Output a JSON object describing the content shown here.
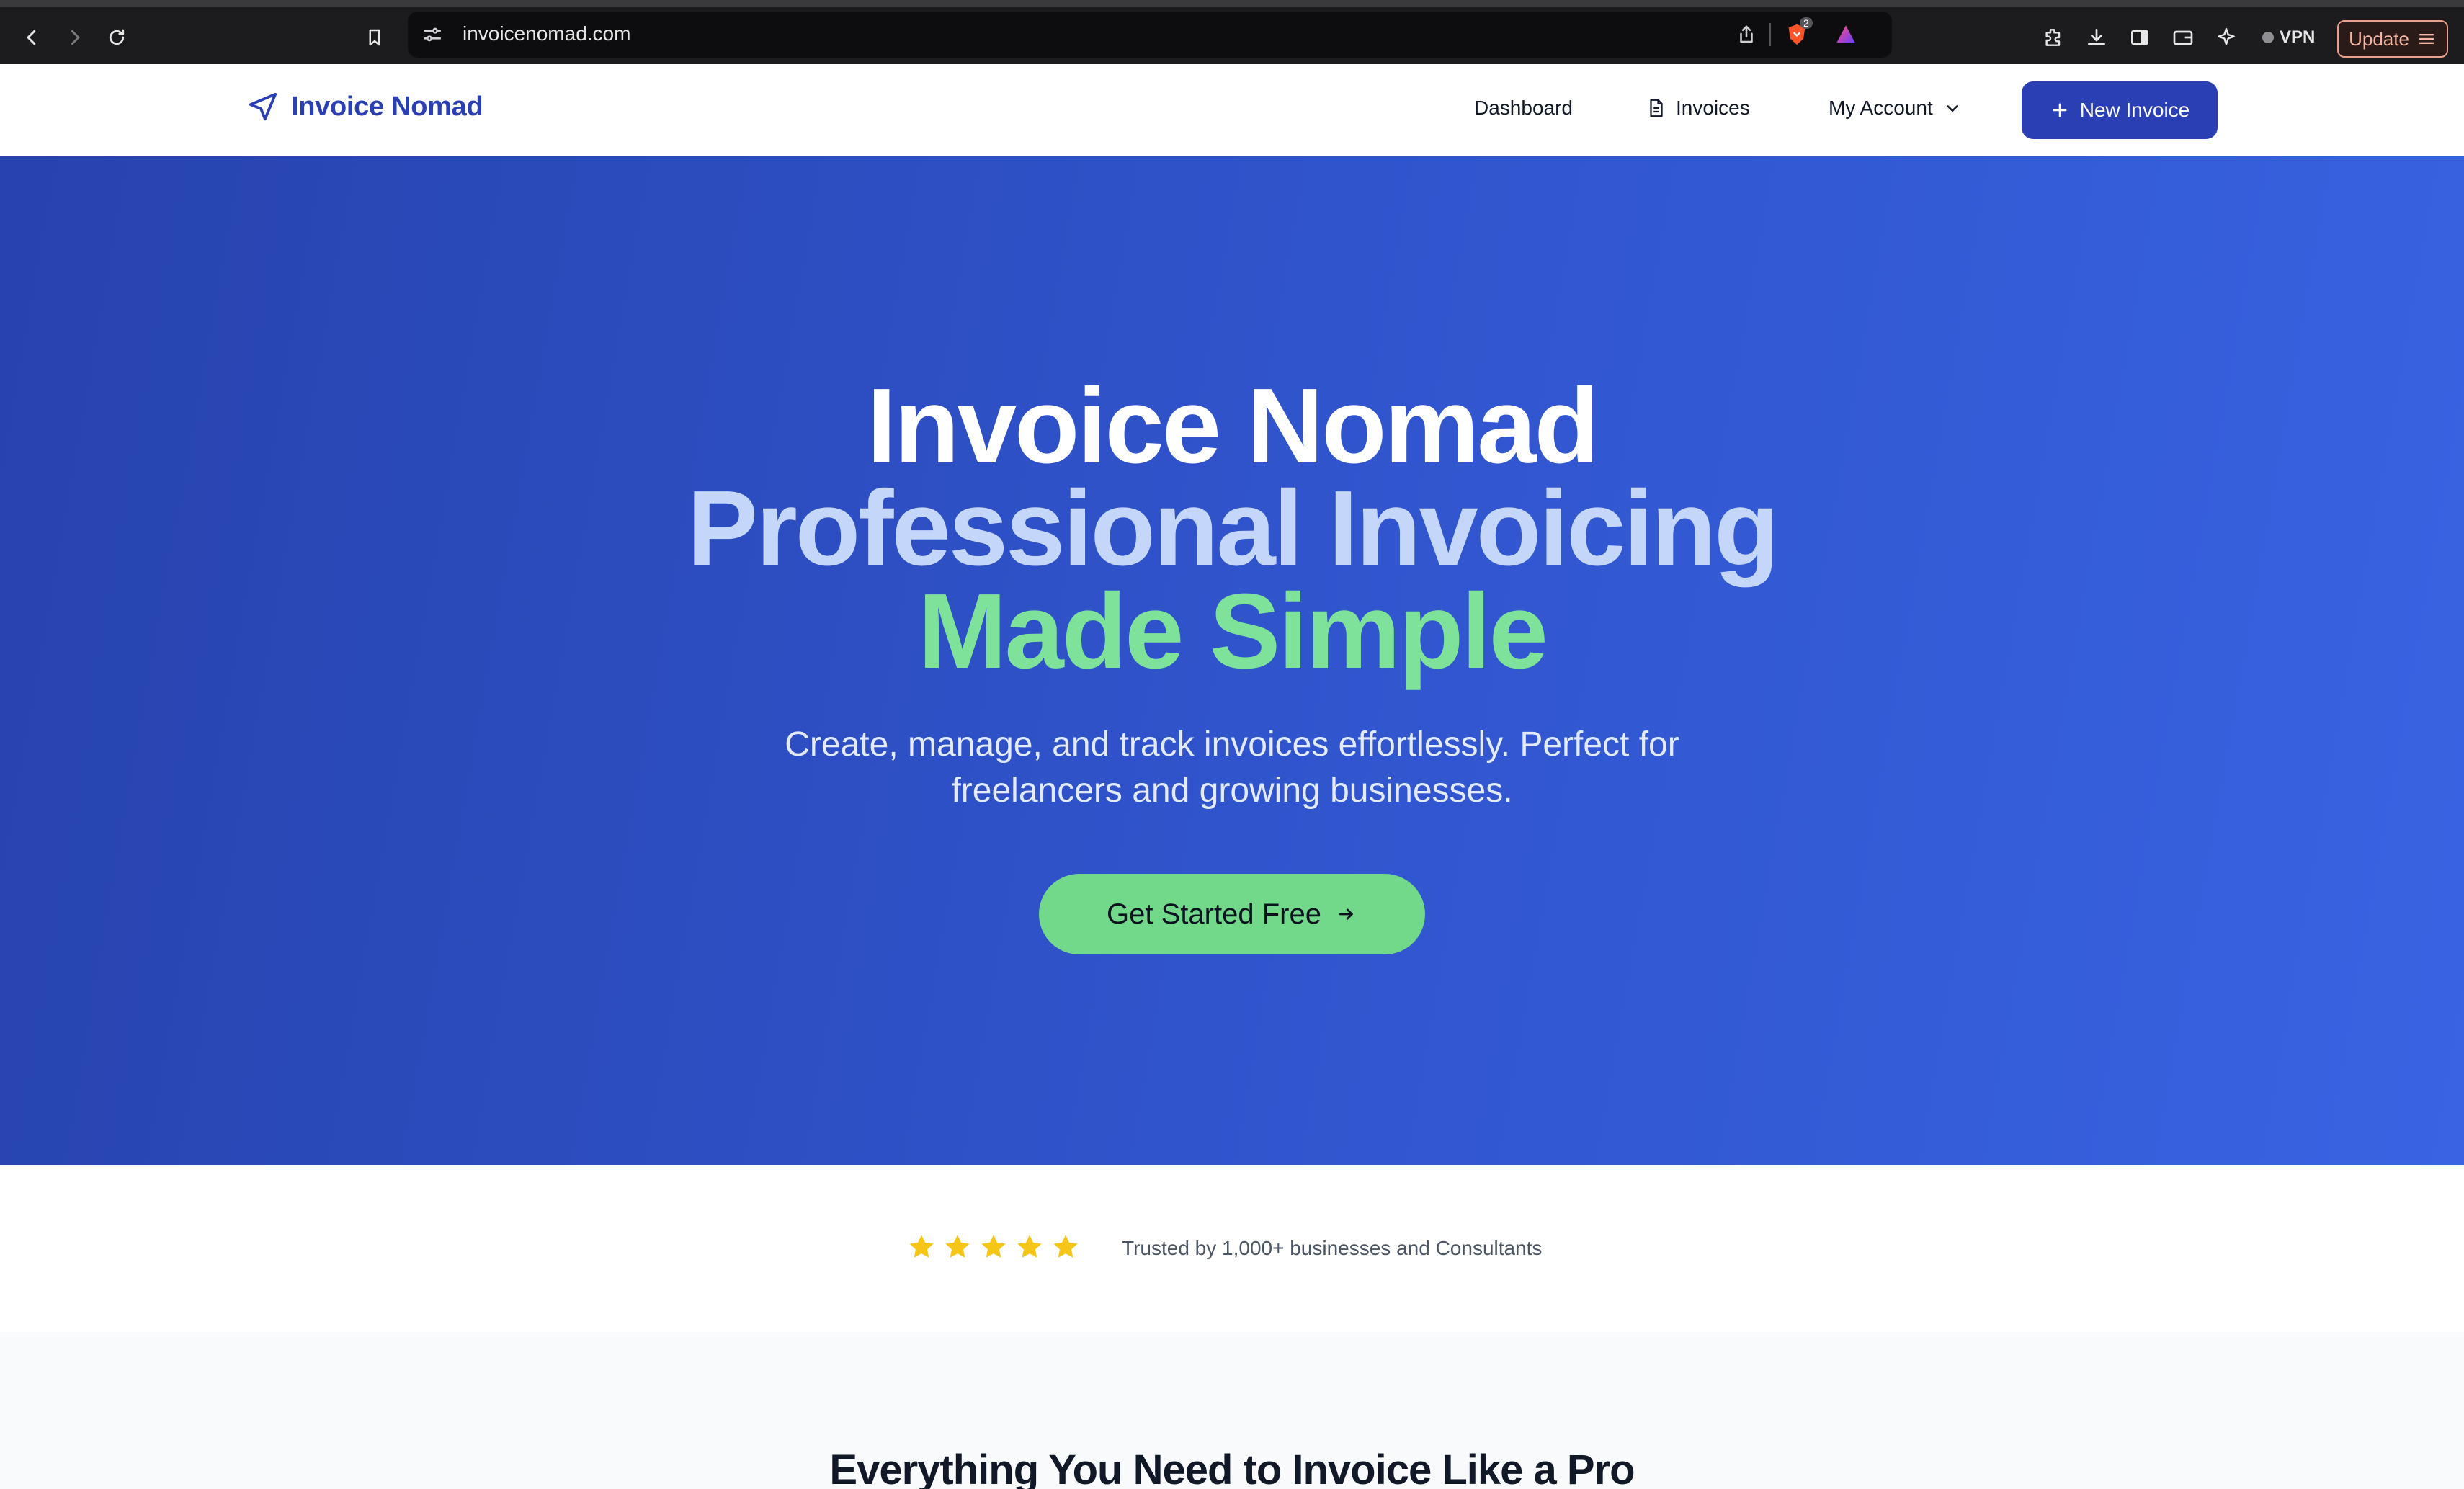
{
  "browser": {
    "url": "invoicenomad.com",
    "shield_badge": "2",
    "vpn_label": "VPN",
    "update_label": "Update"
  },
  "header": {
    "brand": "Invoice Nomad",
    "nav": {
      "dashboard": "Dashboard",
      "invoices": "Invoices",
      "account": "My Account"
    },
    "new_invoice": "New Invoice"
  },
  "hero": {
    "line1": "Invoice Nomad",
    "line2": "Professional Invoicing",
    "line3": "Made Simple",
    "subtitle": "Create, manage, and track invoices effortlessly. Perfect for freelancers and growing businesses.",
    "cta": "Get Started Free"
  },
  "trust": {
    "rating_stars": 5,
    "text": "Trusted by 1,000+ businesses and Consultants"
  },
  "features": {
    "title": "Everything You Need to Invoice Like a Pro"
  },
  "colors": {
    "brand": "#2b3fb4",
    "hero_gradient_start": "#2743ad",
    "hero_gradient_end": "#3863e2",
    "accent_green": "#72d98a",
    "star": "#f5c518"
  }
}
